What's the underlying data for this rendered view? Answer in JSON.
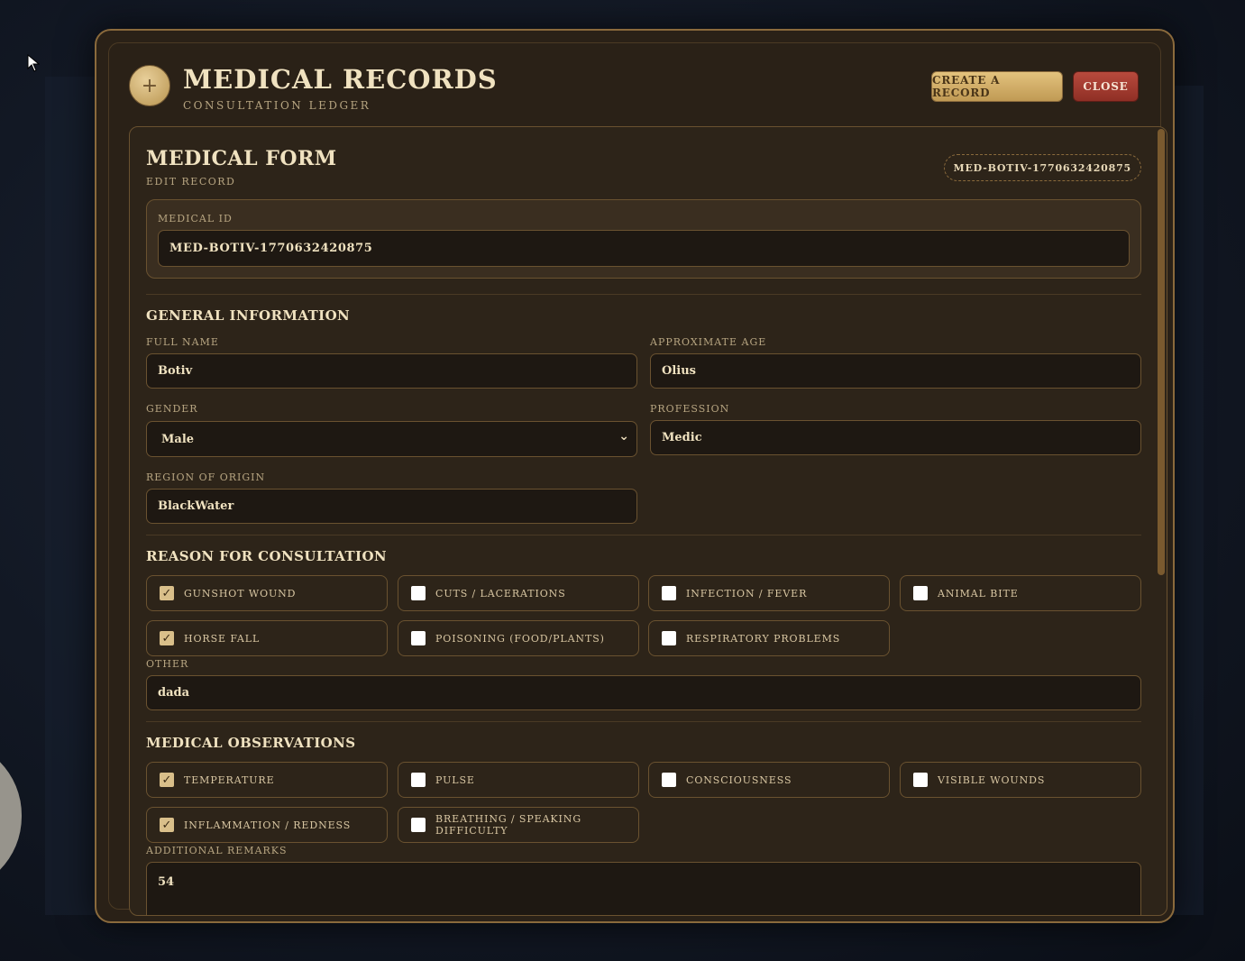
{
  "app": {
    "title": "MEDICAL RECORDS",
    "subtitle": "CONSULTATION LEDGER",
    "logo_icon": "+",
    "buttons": {
      "create": "CREATE A RECORD",
      "close": "CLOSE"
    }
  },
  "form": {
    "title": "MEDICAL FORM",
    "subtitle": "EDIT RECORD",
    "badge": "MED-BOTIV-1770632420875",
    "medical_id": {
      "label": "MEDICAL ID",
      "value": "MED-BOTIV-1770632420875"
    }
  },
  "general": {
    "title": "GENERAL INFORMATION",
    "full_name": {
      "label": "FULL NAME",
      "value": "Botiv"
    },
    "age": {
      "label": "APPROXIMATE AGE",
      "value": "Olius"
    },
    "gender": {
      "label": "GENDER",
      "value": "Male"
    },
    "profession": {
      "label": "PROFESSION",
      "value": "Medic"
    },
    "region": {
      "label": "REGION OF ORIGIN",
      "value": "BlackWater"
    }
  },
  "consultation": {
    "title": "REASON FOR CONSULTATION",
    "options": [
      {
        "label": "GUNSHOT WOUND",
        "checked": true
      },
      {
        "label": "CUTS / LACERATIONS",
        "checked": false
      },
      {
        "label": "INFECTION / FEVER",
        "checked": false
      },
      {
        "label": "ANIMAL BITE",
        "checked": false
      },
      {
        "label": "HORSE FALL",
        "checked": true
      },
      {
        "label": "POISONING (FOOD/PLANTS)",
        "checked": false
      },
      {
        "label": "RESPIRATORY PROBLEMS",
        "checked": false
      }
    ],
    "other": {
      "label": "OTHER",
      "value": "dada"
    }
  },
  "observations": {
    "title": "MEDICAL OBSERVATIONS",
    "options": [
      {
        "label": "TEMPERATURE",
        "checked": true
      },
      {
        "label": "PULSE",
        "checked": false
      },
      {
        "label": "CONSCIOUSNESS",
        "checked": false
      },
      {
        "label": "VISIBLE WOUNDS",
        "checked": false
      },
      {
        "label": "INFLAMMATION / REDNESS",
        "checked": true
      },
      {
        "label": "BREATHING / SPEAKING DIFFICULTY",
        "checked": false
      }
    ],
    "remarks": {
      "label": "ADDITIONAL REMARKS",
      "value": "54"
    }
  },
  "colors": {
    "accent": "#c09a54",
    "danger": "#8f2f25",
    "panel": "#2d2419"
  }
}
